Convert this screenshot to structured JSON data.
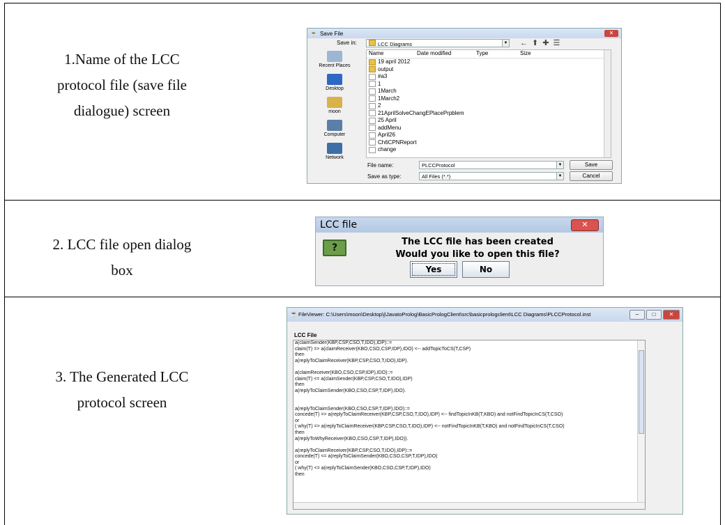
{
  "rows": [
    {
      "lines": [
        "1.Name of  the LCC",
        "protocol file (save file",
        "dialogue) screen"
      ]
    },
    {
      "lines": [
        "2. LCC file open dialog",
        "box"
      ]
    },
    {
      "lines": [
        "3. The Generated LCC",
        "protocol screen"
      ]
    }
  ],
  "save_dialog": {
    "title": "Save File",
    "save_in_label": "Save in:",
    "save_in_value": "LCC Diagrams",
    "places": [
      "Recent Places",
      "Desktop",
      "moon",
      "Computer",
      "Network"
    ],
    "columns": [
      "Name",
      "Date modified",
      "Type",
      "Size"
    ],
    "files": [
      {
        "name": "19 april 2012",
        "kind": "folder"
      },
      {
        "name": "output",
        "kind": "folder"
      },
      {
        "name": "#a3",
        "kind": "file"
      },
      {
        "name": "1",
        "kind": "file"
      },
      {
        "name": "1March",
        "kind": "file"
      },
      {
        "name": "1March2",
        "kind": "file"
      },
      {
        "name": "2",
        "kind": "file"
      },
      {
        "name": "21AprilSolveChangEPlacePrpblem",
        "kind": "file"
      },
      {
        "name": "25 April",
        "kind": "file"
      },
      {
        "name": "addMenu",
        "kind": "file"
      },
      {
        "name": "April26",
        "kind": "file"
      },
      {
        "name": "Ch6CPNReport",
        "kind": "file"
      },
      {
        "name": "change",
        "kind": "file"
      }
    ],
    "file_name_label": "File name:",
    "file_name_value": "PLCCProtocol",
    "save_as_label": "Save as type:",
    "save_as_value": "All Files (*.*)",
    "save_button": "Save",
    "cancel_button": "Cancel"
  },
  "lcc_popup": {
    "title": "LCC file",
    "icon": "?",
    "message_1": "The LCC file has been created",
    "message_2": "Would you like to open this file?",
    "yes_button": "Yes",
    "no_button": "No"
  },
  "viewer": {
    "title": "FileViewer: C:\\Users\\moon\\Desktop\\j\\JavatoProlog\\BasicPrologClient\\src\\basicprologclient\\LCC Diagrams\\PLCCProtocol.inst",
    "section_label": "LCC File",
    "code": [
      "a(claimSender(KBP,CSP,CSO,T,IDO),IDP)::=",
      "claim(T) => a(claimReceiver(KBO,CSO,CSP,IDP),IDO) <-- addTopicToCS(T,CSP)",
      "then",
      "a(replyToClaimReceiver(KBP,CSP,CSO,T,IDO),IDP).",
      "",
      "a(claimReceiver(KBO,CSO,CSP,IDP),IDO)::=",
      "claim(T) <= a(claimSender(KBP,CSP,CSO,T,IDO),IDP)",
      "then",
      "a(replyToClaimSender(KBO,CSO,CSP,T,IDP),IDO).",
      "",
      "",
      "a(replyToClaimSender(KBO,CSO,CSP,T,IDP),IDO)::=",
      "concede(T) => a(replyToClaimReceiver(KBP,CSP,CSO,T,IDO),IDP) <-- findTopicInKB(T,KBO) and notFindTopicInCS(T,CSO)",
      "or",
      "( why(T) => a(replyToClaimReceiver(KBP,CSP,CSO,T,IDO),IDP) <-- notFindTopicInKB(T,KBO) and notFindTopicInCS(T,CSO)",
      "then",
      "a(replyToWhyReceiver(KBO,CSO,CSP,T,IDP),IDO)).",
      "",
      "a(replyToClaimReceiver(KBP,CSP,CSO,T,IDO),IDP)::=",
      "concede(T) <= a(replyToClaimSender(KBO,CSO,CSP,T,IDP),IDO)",
      "or",
      "( why(T) <= a(replyToClaimSender(KBO,CSO,CSP,T,IDP),IDO)",
      "then"
    ]
  }
}
